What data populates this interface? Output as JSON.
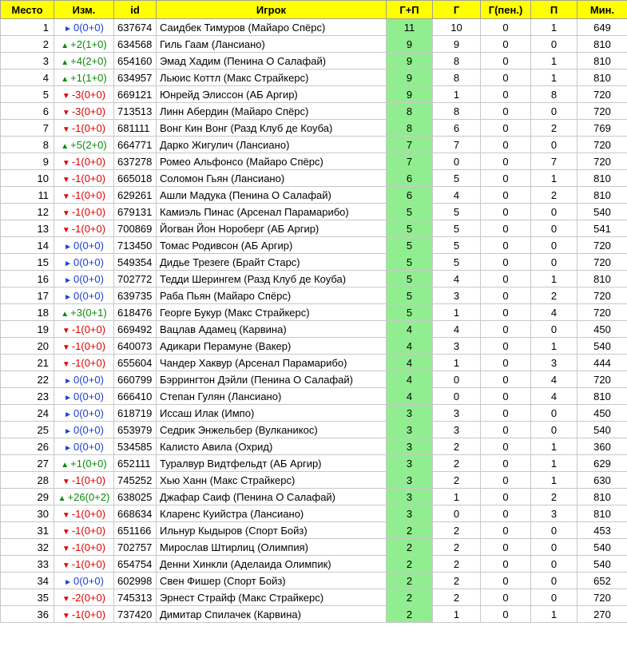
{
  "columns": [
    "Место",
    "Изм.",
    "id",
    "Игрок",
    "Г+П",
    "Г",
    "Г(пен.)",
    "П",
    "Мин."
  ],
  "colors": {
    "header_bg": "#ffff00",
    "gp_bg": "#90ee90",
    "up": "#0a8a0a",
    "down": "#e00000",
    "same": "#1a3fd6"
  },
  "rows": [
    {
      "place": "1",
      "dir": "same",
      "change": "0(0+0)",
      "id": "637674",
      "player": "Саидбек Тимуров (Майаро Спёрс)",
      "gp": "11",
      "g": "10",
      "gpen": "0",
      "p": "1",
      "min": "649"
    },
    {
      "place": "2",
      "dir": "up",
      "change": "+2(1+0)",
      "id": "634568",
      "player": "Гиль Гаам (Лансиано)",
      "gp": "9",
      "g": "9",
      "gpen": "0",
      "p": "0",
      "min": "810"
    },
    {
      "place": "3",
      "dir": "up",
      "change": "+4(2+0)",
      "id": "654160",
      "player": "Эмад Хадим (Пенина О Салафай)",
      "gp": "9",
      "g": "8",
      "gpen": "0",
      "p": "1",
      "min": "810"
    },
    {
      "place": "4",
      "dir": "up",
      "change": "+1(1+0)",
      "id": "634957",
      "player": "Льюис Коттл (Макс Страйкерс)",
      "gp": "9",
      "g": "8",
      "gpen": "0",
      "p": "1",
      "min": "810"
    },
    {
      "place": "5",
      "dir": "down",
      "change": "-3(0+0)",
      "id": "669121",
      "player": "Юнрейд Элиссон (АБ Аргир)",
      "gp": "9",
      "g": "1",
      "gpen": "0",
      "p": "8",
      "min": "720"
    },
    {
      "place": "6",
      "dir": "down",
      "change": "-3(0+0)",
      "id": "713513",
      "player": "Линн Абердин (Майаро Спёрс)",
      "gp": "8",
      "g": "8",
      "gpen": "0",
      "p": "0",
      "min": "720"
    },
    {
      "place": "7",
      "dir": "down",
      "change": "-1(0+0)",
      "id": "681111",
      "player": "Вонг Кин Вонг (Разд Клуб де Коуба)",
      "gp": "8",
      "g": "6",
      "gpen": "0",
      "p": "2",
      "min": "769"
    },
    {
      "place": "8",
      "dir": "up",
      "change": "+5(2+0)",
      "id": "664771",
      "player": "Дарко Жигулич (Лансиано)",
      "gp": "7",
      "g": "7",
      "gpen": "0",
      "p": "0",
      "min": "720"
    },
    {
      "place": "9",
      "dir": "down",
      "change": "-1(0+0)",
      "id": "637278",
      "player": "Ромео Альфонсо (Майаро Спёрс)",
      "gp": "7",
      "g": "0",
      "gpen": "0",
      "p": "7",
      "min": "720"
    },
    {
      "place": "10",
      "dir": "down",
      "change": "-1(0+0)",
      "id": "665018",
      "player": "Соломон Гьян (Лансиано)",
      "gp": "6",
      "g": "5",
      "gpen": "0",
      "p": "1",
      "min": "810"
    },
    {
      "place": "11",
      "dir": "down",
      "change": "-1(0+0)",
      "id": "629261",
      "player": "Ашли Мадука (Пенина О Салафай)",
      "gp": "6",
      "g": "4",
      "gpen": "0",
      "p": "2",
      "min": "810"
    },
    {
      "place": "12",
      "dir": "down",
      "change": "-1(0+0)",
      "id": "679131",
      "player": "Камиэль Пинас (Арсенал Парамарибо)",
      "gp": "5",
      "g": "5",
      "gpen": "0",
      "p": "0",
      "min": "540"
    },
    {
      "place": "13",
      "dir": "down",
      "change": "-1(0+0)",
      "id": "700869",
      "player": "Йогван Йон Нороберг (АБ Аргир)",
      "gp": "5",
      "g": "5",
      "gpen": "0",
      "p": "0",
      "min": "541"
    },
    {
      "place": "14",
      "dir": "same",
      "change": "0(0+0)",
      "id": "713450",
      "player": "Томас Родивсон (АБ Аргир)",
      "gp": "5",
      "g": "5",
      "gpen": "0",
      "p": "0",
      "min": "720"
    },
    {
      "place": "15",
      "dir": "same",
      "change": "0(0+0)",
      "id": "549354",
      "player": "Дидье Трезеге (Брайт Старс)",
      "gp": "5",
      "g": "5",
      "gpen": "0",
      "p": "0",
      "min": "720"
    },
    {
      "place": "16",
      "dir": "same",
      "change": "0(0+0)",
      "id": "702772",
      "player": "Тедди Шерингем (Разд Клуб де Коуба)",
      "gp": "5",
      "g": "4",
      "gpen": "0",
      "p": "1",
      "min": "810"
    },
    {
      "place": "17",
      "dir": "same",
      "change": "0(0+0)",
      "id": "639735",
      "player": "Раба Пьян (Майаро Спёрс)",
      "gp": "5",
      "g": "3",
      "gpen": "0",
      "p": "2",
      "min": "720"
    },
    {
      "place": "18",
      "dir": "up",
      "change": "+3(0+1)",
      "id": "618476",
      "player": "Георге Букур (Макс Страйкерс)",
      "gp": "5",
      "g": "1",
      "gpen": "0",
      "p": "4",
      "min": "720"
    },
    {
      "place": "19",
      "dir": "down",
      "change": "-1(0+0)",
      "id": "669492",
      "player": "Вацлав Адамец (Карвина)",
      "gp": "4",
      "g": "4",
      "gpen": "0",
      "p": "0",
      "min": "450"
    },
    {
      "place": "20",
      "dir": "down",
      "change": "-1(0+0)",
      "id": "640073",
      "player": "Адикари Перамуне (Вакер)",
      "gp": "4",
      "g": "3",
      "gpen": "0",
      "p": "1",
      "min": "540"
    },
    {
      "place": "21",
      "dir": "down",
      "change": "-1(0+0)",
      "id": "655604",
      "player": "Чандер Хаквур (Арсенал Парамарибо)",
      "gp": "4",
      "g": "1",
      "gpen": "0",
      "p": "3",
      "min": "444"
    },
    {
      "place": "22",
      "dir": "same",
      "change": "0(0+0)",
      "id": "660799",
      "player": "Бэррингтон Дэйли (Пенина О Салафай)",
      "gp": "4",
      "g": "0",
      "gpen": "0",
      "p": "4",
      "min": "720"
    },
    {
      "place": "23",
      "dir": "same",
      "change": "0(0+0)",
      "id": "666410",
      "player": "Степан Гулян (Лансиано)",
      "gp": "4",
      "g": "0",
      "gpen": "0",
      "p": "4",
      "min": "810"
    },
    {
      "place": "24",
      "dir": "same",
      "change": "0(0+0)",
      "id": "618719",
      "player": "Иссаш Илак (Импо)",
      "gp": "3",
      "g": "3",
      "gpen": "0",
      "p": "0",
      "min": "450"
    },
    {
      "place": "25",
      "dir": "same",
      "change": "0(0+0)",
      "id": "653979",
      "player": "Седрик Энжельбер (Вулканикос)",
      "gp": "3",
      "g": "3",
      "gpen": "0",
      "p": "0",
      "min": "540"
    },
    {
      "place": "26",
      "dir": "same",
      "change": "0(0+0)",
      "id": "534585",
      "player": "Калисто Авила (Охрид)",
      "gp": "3",
      "g": "2",
      "gpen": "0",
      "p": "1",
      "min": "360"
    },
    {
      "place": "27",
      "dir": "up",
      "change": "+1(0+0)",
      "id": "652111",
      "player": "Туралвур Видтфельдт (АБ Аргир)",
      "gp": "3",
      "g": "2",
      "gpen": "0",
      "p": "1",
      "min": "629"
    },
    {
      "place": "28",
      "dir": "down",
      "change": "-1(0+0)",
      "id": "745252",
      "player": "Хью Ханн (Макс Страйкерс)",
      "gp": "3",
      "g": "2",
      "gpen": "0",
      "p": "1",
      "min": "630"
    },
    {
      "place": "29",
      "dir": "up",
      "change": "+26(0+2)",
      "id": "638025",
      "player": "Джафар Саиф (Пенина О Салафай)",
      "gp": "3",
      "g": "1",
      "gpen": "0",
      "p": "2",
      "min": "810"
    },
    {
      "place": "30",
      "dir": "down",
      "change": "-1(0+0)",
      "id": "668634",
      "player": "Кларенс Куийстра (Лансиано)",
      "gp": "3",
      "g": "0",
      "gpen": "0",
      "p": "3",
      "min": "810"
    },
    {
      "place": "31",
      "dir": "down",
      "change": "-1(0+0)",
      "id": "651166",
      "player": "Ильнур Кыдыров (Спорт Бойз)",
      "gp": "2",
      "g": "2",
      "gpen": "0",
      "p": "0",
      "min": "453"
    },
    {
      "place": "32",
      "dir": "down",
      "change": "-1(0+0)",
      "id": "702757",
      "player": "Мирослав Штирлиц (Олимпия)",
      "gp": "2",
      "g": "2",
      "gpen": "0",
      "p": "0",
      "min": "540"
    },
    {
      "place": "33",
      "dir": "down",
      "change": "-1(0+0)",
      "id": "654754",
      "player": "Денни Хинкли (Аделаида Олимпик)",
      "gp": "2",
      "g": "2",
      "gpen": "0",
      "p": "0",
      "min": "540"
    },
    {
      "place": "34",
      "dir": "same",
      "change": "0(0+0)",
      "id": "602998",
      "player": "Свен Фишер (Спорт Бойз)",
      "gp": "2",
      "g": "2",
      "gpen": "0",
      "p": "0",
      "min": "652"
    },
    {
      "place": "35",
      "dir": "down",
      "change": "-2(0+0)",
      "id": "745313",
      "player": "Эрнест Страйф (Макс Страйкерс)",
      "gp": "2",
      "g": "2",
      "gpen": "0",
      "p": "0",
      "min": "720"
    },
    {
      "place": "36",
      "dir": "down",
      "change": "-1(0+0)",
      "id": "737420",
      "player": "Димитар Спилачек (Карвина)",
      "gp": "2",
      "g": "1",
      "gpen": "0",
      "p": "1",
      "min": "270"
    }
  ]
}
